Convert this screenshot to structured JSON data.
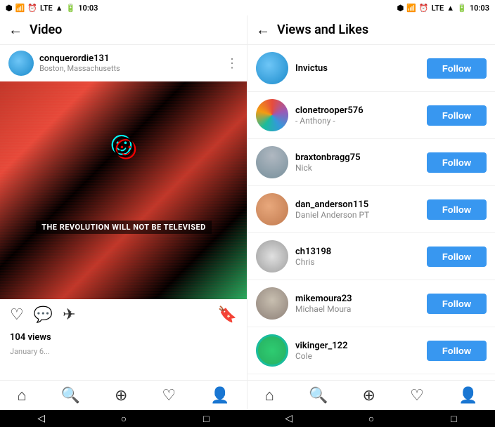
{
  "statusBar": {
    "leftTime": "10:03",
    "rightTime": "10:03",
    "leftIcons": [
      "bluetooth",
      "signal",
      "alarm",
      "lte",
      "wifi-bars",
      "battery"
    ],
    "rightIcons": [
      "bluetooth",
      "signal",
      "alarm",
      "lte",
      "wifi-bars",
      "battery"
    ]
  },
  "leftPanel": {
    "title": "Video",
    "backArrow": "←",
    "post": {
      "username": "conquerordie131",
      "location": "Boston, Massachusetts",
      "imageText": "THE REVOLUTION WILL NOT BE TELEVISED",
      "views": "104 views",
      "date": "January 6..."
    }
  },
  "rightPanel": {
    "title": "Views and Likes",
    "backArrow": "←",
    "users": [
      {
        "handle": "Invictus",
        "name": "",
        "avatarClass": "av-1"
      },
      {
        "handle": "clonetrooper576",
        "name": "- Anthony -",
        "avatarClass": "av-2"
      },
      {
        "handle": "braxtonbragg75",
        "name": "Nick",
        "avatarClass": "av-3"
      },
      {
        "handle": "dan_anderson115",
        "name": "Daniel Anderson PT",
        "avatarClass": "av-4"
      },
      {
        "handle": "ch13198",
        "name": "Chris",
        "avatarClass": "av-5"
      },
      {
        "handle": "mikemoura23",
        "name": "Michael Moura",
        "avatarClass": "av-6"
      },
      {
        "handle": "vikinger_122",
        "name": "Cole",
        "avatarClass": "av-7"
      }
    ],
    "followLabel": "Follow"
  },
  "bottomNav": {
    "icons": [
      "home",
      "search",
      "add",
      "heart",
      "profile"
    ]
  }
}
